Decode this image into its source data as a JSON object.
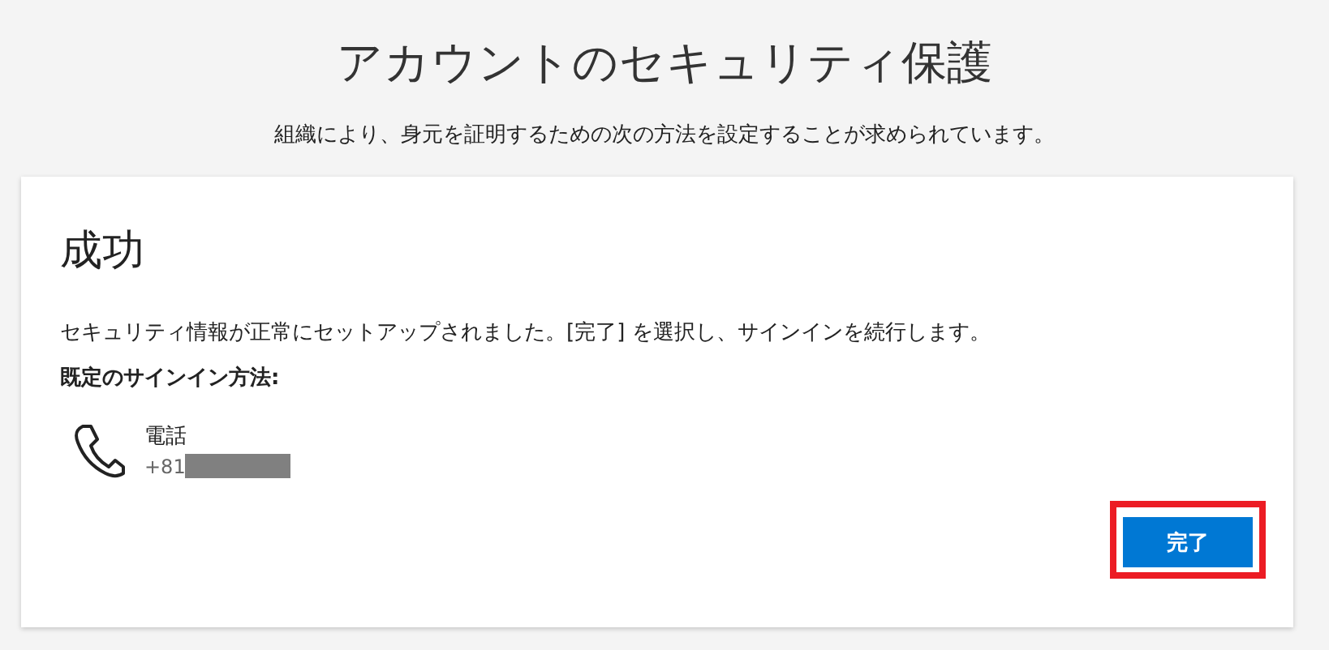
{
  "page": {
    "title": "アカウントのセキュリティ保護",
    "subtitle": "組織により、身元を証明するための次の方法を設定することが求められています。"
  },
  "card": {
    "title": "成功",
    "message": "セキュリティ情報が正常にセットアップされました。[完了] を選択し、サインインを続行します。",
    "default_method_label": "既定のサインイン方法:",
    "method": {
      "name": "電話",
      "number": "+81",
      "redacted": true
    },
    "button": {
      "label": "完了",
      "highlighted": true
    }
  }
}
